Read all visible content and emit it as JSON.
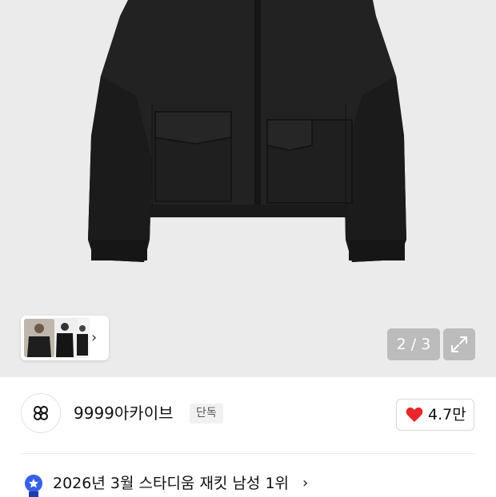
{
  "product_image": {
    "counter": "2 / 3",
    "thumbnail_next": "›",
    "expand": "expand-icon"
  },
  "seller": {
    "name": "9999아카이브",
    "badge": "단독",
    "like_count": "4.7만",
    "like_color": "#e8262b"
  },
  "ranking": {
    "text": "2026년 3월 스타디움 재킷 남성 1위",
    "chevron": "›",
    "icon_color": "#3660e6"
  }
}
